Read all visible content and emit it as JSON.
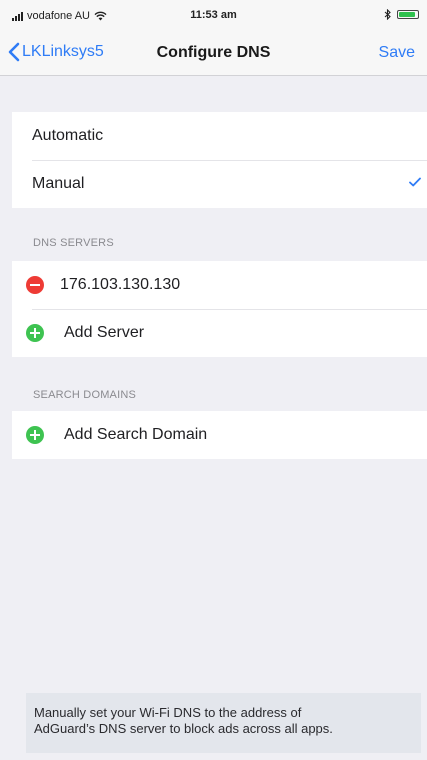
{
  "status_bar": {
    "carrier": "vodafone AU",
    "time": "11:53 am",
    "bluetooth_icon": "bluetooth-icon",
    "battery_level": 0.9,
    "battery_color": "#2ec14d"
  },
  "nav": {
    "back_label": "LKLinksys5",
    "title": "Configure DNS",
    "save_label": "Save",
    "tint_color": "#2f7cf6"
  },
  "mode": {
    "options": [
      {
        "label": "Automatic",
        "selected": false
      },
      {
        "label": "Manual",
        "selected": true
      }
    ]
  },
  "dns_servers": {
    "header": "DNS SERVERS",
    "servers": [
      "176.103.130.130"
    ],
    "add_label": "Add Server"
  },
  "search_domains": {
    "header": "SEARCH DOMAINS",
    "add_label": "Add Search Domain"
  },
  "caption": {
    "line1": "Manually set your Wi-Fi DNS to the address of",
    "line2": "AdGuard’s DNS server to block ads across all apps."
  },
  "colors": {
    "remove": "#ee3b35",
    "add": "#3ec351",
    "background": "#efeff4"
  }
}
